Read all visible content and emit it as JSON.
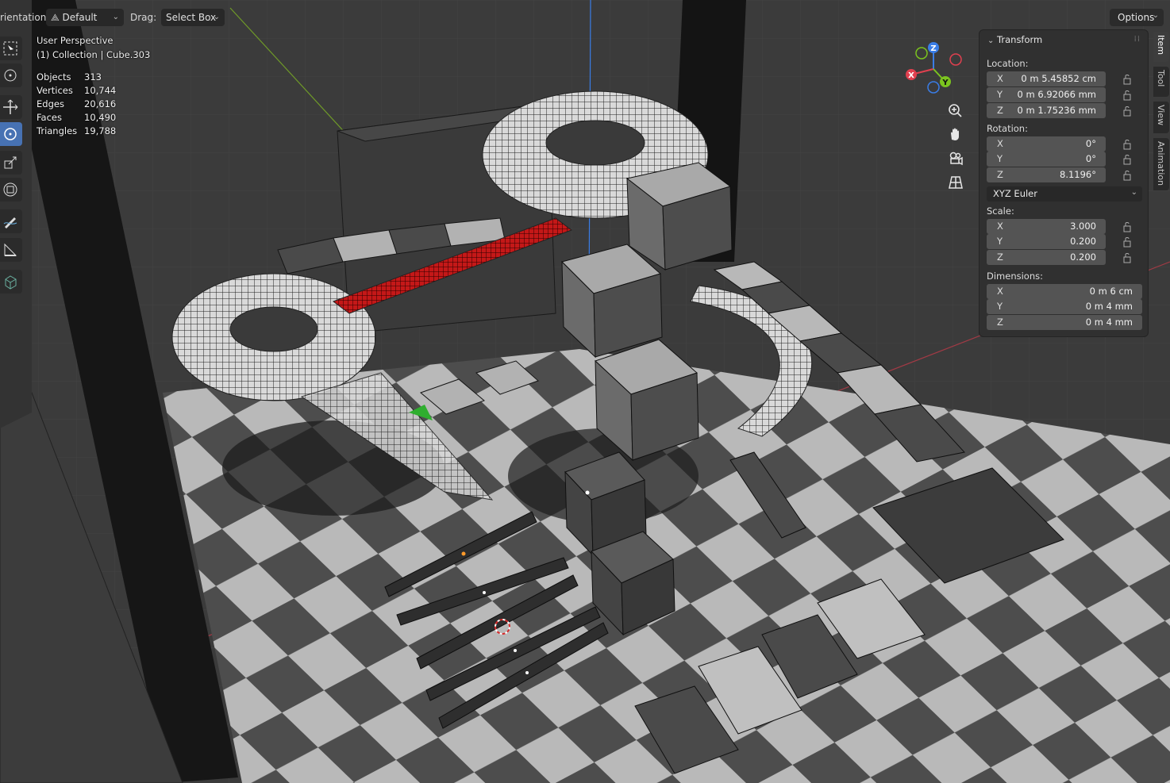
{
  "header": {
    "orientation_label": "rientation:",
    "orientation_value": "Default",
    "drag_label": "Drag:",
    "drag_value": "Select Box",
    "options_label": "Options"
  },
  "overlay": {
    "view_name": "User Perspective",
    "collection": "(1) Collection | Cube.303",
    "stats": [
      {
        "label": "Objects",
        "value": "313"
      },
      {
        "label": "Vertices",
        "value": "10,744"
      },
      {
        "label": "Edges",
        "value": "20,616"
      },
      {
        "label": "Faces",
        "value": "10,490"
      },
      {
        "label": "Triangles",
        "value": "19,788"
      }
    ]
  },
  "gizmo": {
    "x": "X",
    "y": "Y",
    "z": "Z"
  },
  "panel": {
    "title": "Transform",
    "location_label": "Location:",
    "location": [
      {
        "axis": "X",
        "value": "0 m 5.45852 cm"
      },
      {
        "axis": "Y",
        "value": "0 m 6.92066 mm"
      },
      {
        "axis": "Z",
        "value": "0 m 1.75236 mm"
      }
    ],
    "rotation_label": "Rotation:",
    "rotation": [
      {
        "axis": "X",
        "value": "0°"
      },
      {
        "axis": "Y",
        "value": "0°"
      },
      {
        "axis": "Z",
        "value": "8.1196°"
      }
    ],
    "rotation_mode": "XYZ Euler",
    "scale_label": "Scale:",
    "scale": [
      {
        "axis": "X",
        "value": "3.000"
      },
      {
        "axis": "Y",
        "value": "0.200"
      },
      {
        "axis": "Z",
        "value": "0.200"
      }
    ],
    "dimensions_label": "Dimensions:",
    "dimensions": [
      {
        "axis": "X",
        "value": "0 m 6 cm"
      },
      {
        "axis": "Y",
        "value": "0 m 4 mm"
      },
      {
        "axis": "Z",
        "value": "0 m 4 mm"
      }
    ]
  },
  "sidebar_tabs": [
    "Item",
    "Tool",
    "View",
    "Animation"
  ],
  "colors": {
    "accent": "#4772b3",
    "axis_x": "#e0404f",
    "axis_y": "#7bc31f",
    "axis_z": "#3a7de6",
    "panel_bg": "#303030",
    "field_bg": "#545454"
  }
}
